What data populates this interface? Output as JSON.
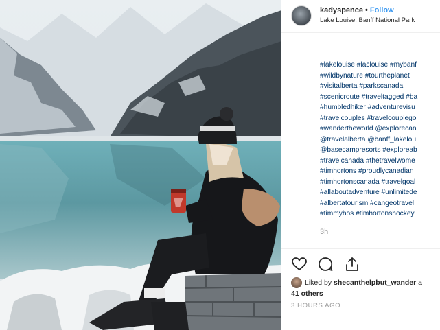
{
  "post": {
    "username": "kadyspence",
    "separator": "•",
    "follow_label": "Follow",
    "location": "Lake Louise, Banff National Park"
  },
  "caption_lines": [
    ".",
    ".",
    "#lakelouise #laclouise #mybanf",
    "#wildbynature #tourtheplanet",
    "#visitalberta #parkscanada",
    "#scenicroute #traveltagged #ba",
    "#humbledhiker #adventurevisu",
    "#travelcouples #travelcouplego",
    "#wandertheworld @explorecan",
    "@travelalberta @banff_lakelou",
    "@basecampresorts #exploreab",
    "#travelcanada #thetravelwome",
    "#timhortons #proudlycanadian",
    "#timhortonscanada #travelgoal",
    "#allaboutadventure #unlimitede",
    "#albertatourism #cangeotravel",
    "#timmyhos #timhortonshockey"
  ],
  "comment_time": "3h",
  "actions": {
    "like_icon": "heart-icon",
    "comment_icon": "comment-icon",
    "share_icon": "share-icon"
  },
  "likes": {
    "prefix": "Liked by",
    "user": "shecanthelpbut_wander",
    "suffix": "a",
    "others": "41 others"
  },
  "posted_ago": "3 HOURS AGO",
  "colors": {
    "follow": "#3897f0",
    "hashtag": "#003569",
    "muted": "#999999",
    "lake": "#5f9aa3",
    "cup": "#c0392b"
  }
}
